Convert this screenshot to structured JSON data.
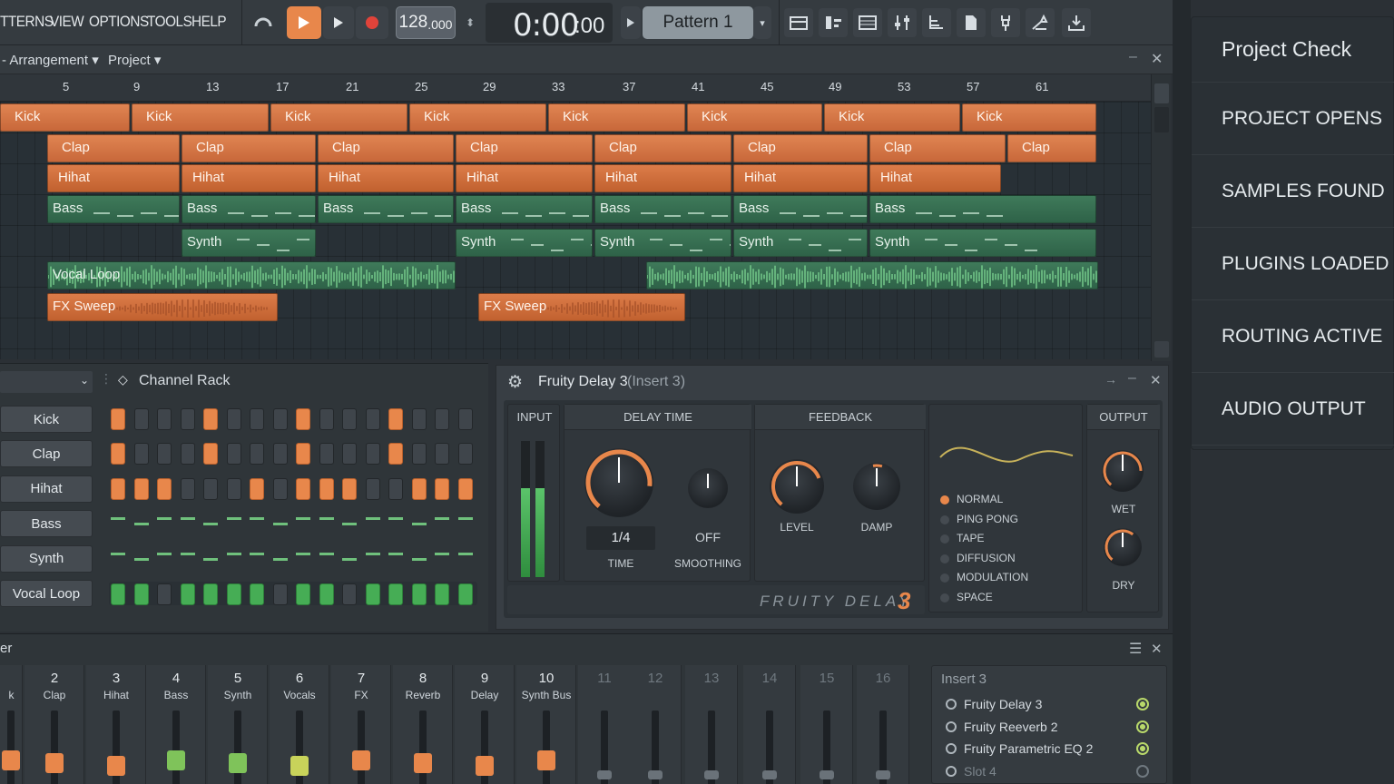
{
  "menu": {
    "items": [
      "TTERNS",
      "VIEW",
      "OPTIONS",
      "TOOLS",
      "HELP"
    ]
  },
  "transport": {
    "tempo_main": "128",
    "tempo_dec": ".000",
    "time_main": "0:00",
    "time_sub": ":00",
    "pattern": "Pattern 1"
  },
  "arrangement": {
    "title": "Arrangement",
    "project": "Project",
    "ruler": [
      "5",
      "9",
      "13",
      "17",
      "21",
      "25",
      "29",
      "33",
      "37",
      "41",
      "45",
      "49",
      "53",
      "57",
      "61"
    ],
    "kick": "Kick",
    "clap": "Clap",
    "hihat": "Hihat",
    "bass": "Bass",
    "synth": "Synth",
    "vocal": "Vocal Loop",
    "fx": "FX Sweep"
  },
  "channel_rack": {
    "title": "Channel Rack",
    "channels": [
      "Kick",
      "Clap",
      "Hihat",
      "Bass",
      "Synth",
      "Vocal Loop"
    ]
  },
  "delay": {
    "title": "Fruity Delay 3",
    "insert": "(Insert 3)",
    "input": "INPUT",
    "delay_time": "DELAY TIME",
    "feedback": "FEEDBACK",
    "output": "OUTPUT",
    "time_value": "1/4",
    "time_label": "TIME",
    "smoothing_value": "OFF",
    "smoothing_label": "SMOOTHING",
    "level": "LEVEL",
    "damp": "DAMP",
    "wet": "WET",
    "dry": "DRY",
    "modes": [
      "NORMAL",
      "PING PONG",
      "TAPE",
      "DIFFUSION",
      "MODULATION",
      "SPACE"
    ],
    "selected_mode": "NORMAL",
    "brand": "FRUITY DELAY",
    "brand_num": "3"
  },
  "mixer": {
    "title": "er",
    "strips": [
      {
        "num": "",
        "name": "k"
      },
      {
        "num": "2",
        "name": "Clap"
      },
      {
        "num": "3",
        "name": "Hihat"
      },
      {
        "num": "4",
        "name": "Bass"
      },
      {
        "num": "5",
        "name": "Synth"
      },
      {
        "num": "6",
        "name": "Vocals"
      },
      {
        "num": "7",
        "name": "FX"
      },
      {
        "num": "8",
        "name": "Reverb"
      },
      {
        "num": "9",
        "name": "Delay"
      },
      {
        "num": "10",
        "name": "Synth Bus"
      },
      {
        "num": "11",
        "name": ""
      },
      {
        "num": "12",
        "name": ""
      },
      {
        "num": "13",
        "name": ""
      },
      {
        "num": "14",
        "name": ""
      },
      {
        "num": "15",
        "name": ""
      },
      {
        "num": "16",
        "name": ""
      }
    ],
    "insert_title": "Insert 3",
    "slots": [
      "Fruity Delay 3",
      "Fruity Reeverb 2",
      "Fruity Parametric EQ 2",
      "Slot 4"
    ]
  },
  "project_check": {
    "title": "Project Check",
    "items": [
      "PROJECT OPENS",
      "SAMPLES FOUND",
      "PLUGINS LOADED",
      "ROUTING ACTIVE",
      "AUDIO OUTPUT"
    ]
  },
  "colors": {
    "accent": "#e8874b",
    "green": "#46ad55",
    "bg": "#2b3035"
  }
}
